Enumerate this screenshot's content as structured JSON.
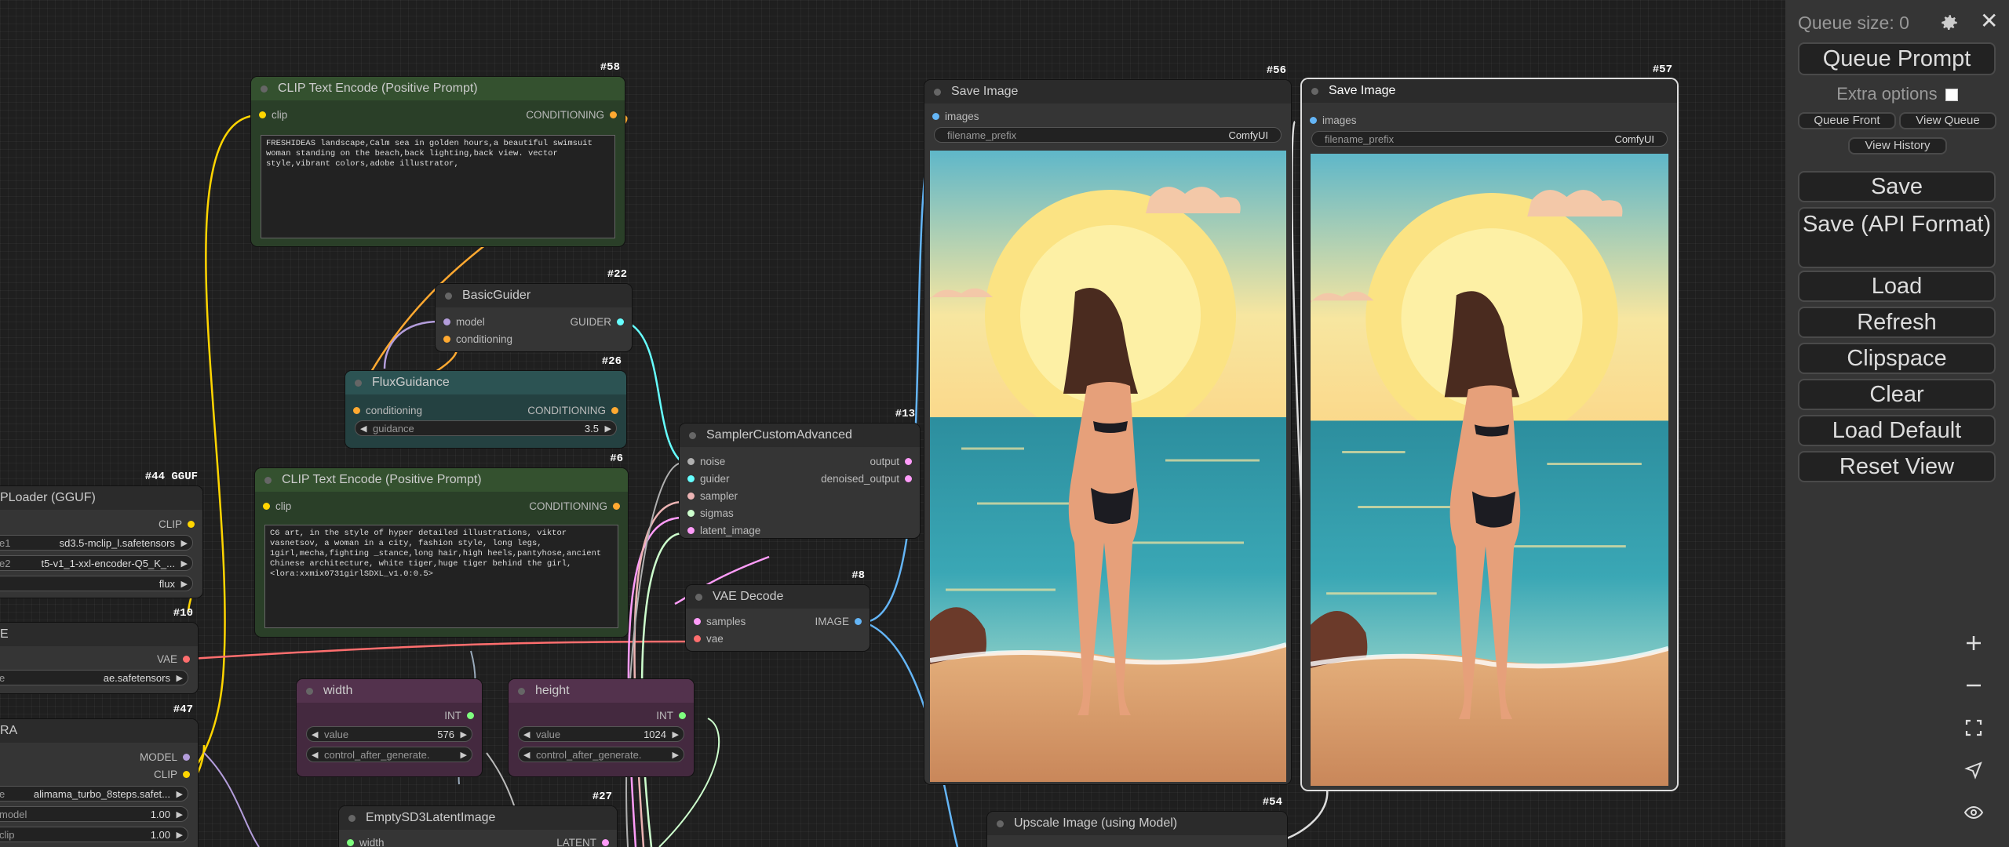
{
  "menu": {
    "queue_size": "Queue size: 0",
    "queue_prompt": "Queue Prompt",
    "extra_options": "Extra options",
    "queue_front": "Queue Front",
    "view_queue": "View Queue",
    "view_history": "View History",
    "save": "Save",
    "save_api": "Save (API Format)",
    "load": "Load",
    "refresh": "Refresh",
    "clipspace": "Clipspace",
    "clear": "Clear",
    "load_default": "Load Default",
    "reset_view": "Reset View"
  },
  "nodes": {
    "n58": {
      "id": "#58",
      "title": "CLIP Text Encode (Positive Prompt)",
      "in_clip": "clip",
      "out": "CONDITIONING",
      "text": "FRESHIDEAS landscape,Calm sea in golden hours,a beautiful swimsuit woman standing on the beach,back lighting,back view. vector style,vibrant colors,adobe illustrator,"
    },
    "n22": {
      "id": "#22",
      "title": "BasicGuider",
      "in_model": "model",
      "in_cond": "conditioning",
      "out": "GUIDER"
    },
    "n26": {
      "id": "#26",
      "title": "FluxGuidance",
      "in_cond": "conditioning",
      "out": "CONDITIONING",
      "w_label": "guidance",
      "w_value": "3.5"
    },
    "n6": {
      "id": "#6",
      "title": "CLIP Text Encode (Positive Prompt)",
      "in_clip": "clip",
      "out": "CONDITIONING",
      "text": "C6 art, in the style of hyper detailed illustrations, viktor vasnetsov, a woman in a city, fashion style, long legs, 1girl,mecha,fighting _stance,long hair,high heels,pantyhose,ancient Chinese architecture, white tiger,huge tiger behind the girl,<lora:xxmix0731girlSDXL_v1.0:0.5>"
    },
    "n13": {
      "id": "#13",
      "title": "SamplerCustomAdvanced",
      "in_noise": "noise",
      "in_guider": "guider",
      "in_sampler": "sampler",
      "in_sigmas": "sigmas",
      "in_latent": "latent_image",
      "out1": "output",
      "out2": "denoised_output"
    },
    "n8": {
      "id": "#8",
      "title": "VAE Decode",
      "in_samples": "samples",
      "in_vae": "vae",
      "out": "IMAGE"
    },
    "n44": {
      "id": "#44 GGUF",
      "title": "PLoader (GGUF)",
      "out": "CLIP",
      "w1_label": "e1",
      "w1_value": "sd3.5-mclip_l.safetensors",
      "w2_label": "e2",
      "w2_value": "t5-v1_1-xxl-encoder-Q5_K_...",
      "w3_value": "flux"
    },
    "n10": {
      "id": "#10",
      "title": "E",
      "out": "VAE",
      "w_label": "e",
      "w_value": "ae.safetensors"
    },
    "n47": {
      "id": "#47",
      "title": "RA",
      "out1": "MODEL",
      "out2": "CLIP",
      "w1_label": "e",
      "w1_value": "alimama_turbo_8steps.safet...",
      "w2_label": "model",
      "w2_value": "1.00",
      "w3_label": "clip",
      "w3_value": "1.00"
    },
    "width": {
      "title": "width",
      "out": "INT",
      "w_label": "value",
      "w_value": "576",
      "w2_label": "control_after_generate."
    },
    "height": {
      "title": "height",
      "out": "INT",
      "w_label": "value",
      "w_value": "1024",
      "w2_label": "control_after_generate."
    },
    "n27": {
      "id": "#27",
      "title": "EmptySD3LatentImage",
      "in_width": "width",
      "out": "LATENT"
    },
    "n56": {
      "id": "#56",
      "title": "Save Image",
      "in": "images",
      "w_label": "filename_prefix",
      "w_value": "ComfyUI"
    },
    "n57": {
      "id": "#57",
      "title": "Save Image",
      "in": "images",
      "w_label": "filename_prefix",
      "w_value": "ComfyUI"
    },
    "n54": {
      "id": "#54",
      "title": "Upscale Image (using Model)"
    }
  },
  "colors": {
    "clip": "#ffd500",
    "conditioning": "#ffa931",
    "model": "#b39ddb",
    "guider": "#66ffff",
    "latent": "#ff9cf9",
    "vae": "#ff6e6e",
    "image": "#64b5f6",
    "int": "#7fff7f",
    "sampler": "#ecb4b4",
    "sigmas": "#cdffcd",
    "noise": "#b0b0b0"
  }
}
